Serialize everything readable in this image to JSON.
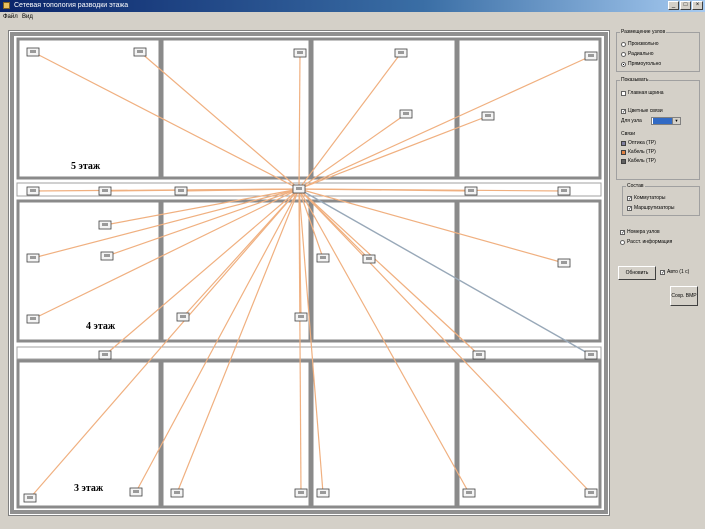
{
  "window": {
    "title": "Сетевая топология разводки этажа"
  },
  "menu": {
    "items": [
      "Файл",
      "Вид"
    ]
  },
  "floors": [
    {
      "label": "5 этаж"
    },
    {
      "label": "4 этаж"
    },
    {
      "label": "3 этаж"
    }
  ],
  "panel": {
    "placement": {
      "title": "Размещение узлов",
      "options": [
        "Произвольно",
        "Радиально",
        "Прямоугольно"
      ],
      "selected": 2
    },
    "display": {
      "title": "Показывать",
      "main_line": "Главная шрина",
      "color_links": "Цветные связи",
      "node_color_label": "Для узла",
      "node_color_value": "",
      "links_title": "Связи",
      "links": [
        {
          "label": "Оптика (TP)",
          "color": "#8080a0"
        },
        {
          "label": "Кабель (TP)",
          "color": "#e08040"
        },
        {
          "label": "Кабель (TP)",
          "color": "#606060"
        }
      ]
    },
    "composition": {
      "title": "Состав",
      "items": [
        "Коммутаторы",
        "Маршрутизаторы"
      ]
    },
    "extra": [
      "Номера узлов",
      "Расст. информация"
    ],
    "refresh_button": "Обновить",
    "auto_label": "Авто (1 с)",
    "save_button": "Сохр. BMP"
  }
}
